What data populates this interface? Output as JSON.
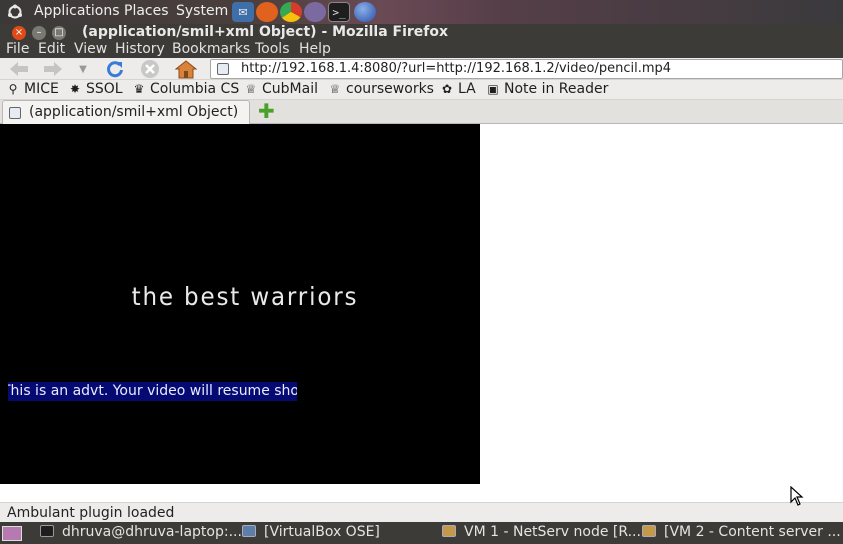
{
  "top_panel": {
    "menus": [
      "Applications",
      "Places",
      "System"
    ],
    "launchers": [
      "thunderbird-icon",
      "firefox-icon",
      "chrome-icon",
      "pidgin-icon",
      "terminal-icon",
      "network-icon"
    ]
  },
  "window": {
    "title": "(application/smil+xml Object) - Mozilla Firefox"
  },
  "menubar": [
    "File",
    "Edit",
    "View",
    "History",
    "Bookmarks",
    "Tools",
    "Help"
  ],
  "navbar": {
    "url": "http://192.168.1.4:8080/?url=http://192.168.1.2/video/pencil.mp4"
  },
  "bookmarks": [
    {
      "label": "MICE",
      "icon": "mice-icon"
    },
    {
      "label": "SSOL",
      "icon": "ssol-icon"
    },
    {
      "label": "Columbia CS",
      "icon": "columbia-icon"
    },
    {
      "label": "CubMail",
      "icon": "crown-icon"
    },
    {
      "label": "courseworks",
      "icon": "crown-icon"
    },
    {
      "label": "LA",
      "icon": "la-icon"
    },
    {
      "label": "Note in Reader",
      "icon": "page-icon"
    }
  ],
  "tabs": [
    {
      "label": "(application/smil+xml Object)",
      "active": true
    }
  ],
  "video": {
    "caption": "the best warriors",
    "ad_text": "This is an advt. Your video will resume shortly"
  },
  "statusbar": {
    "text": "Ambulant plugin loaded"
  },
  "taskbar": [
    {
      "label": "dhruva@dhruva-laptop:...",
      "icon": "terminal-icon"
    },
    {
      "label": "[VirtualBox OSE]",
      "icon": "virtualbox-icon"
    },
    {
      "label": "VM 1 - NetServ node [R...",
      "icon": "vm-icon"
    },
    {
      "label": "[VM 2 - Content server ...",
      "icon": "vm-icon"
    }
  ]
}
